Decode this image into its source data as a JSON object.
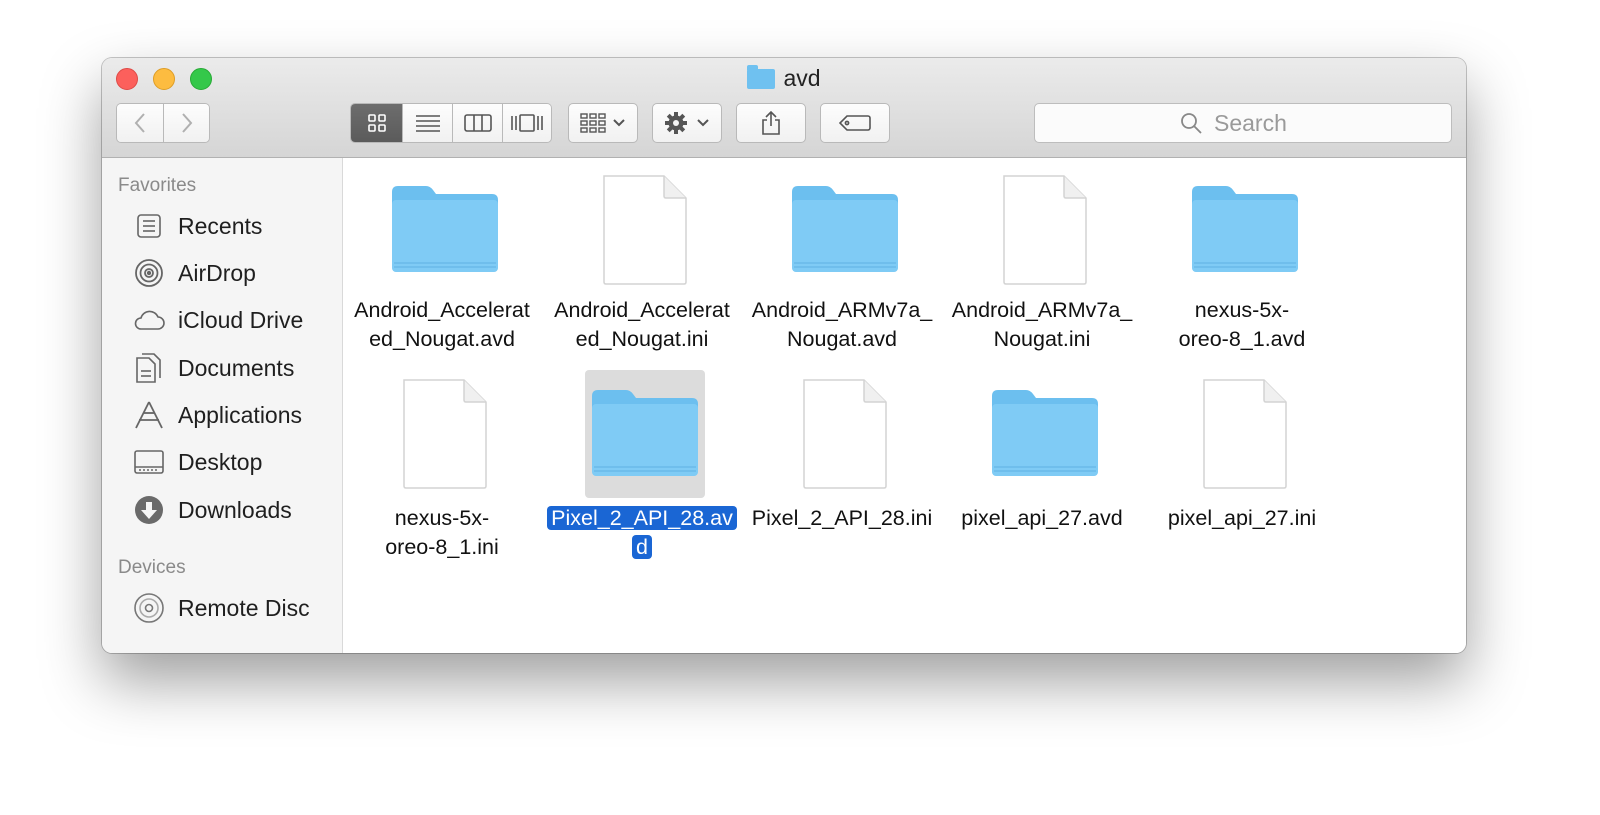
{
  "window": {
    "title": "avd"
  },
  "toolbar": {
    "back_icon": "chevron-left-icon",
    "forward_icon": "chevron-right-icon",
    "view_modes": [
      "icon-view",
      "list-view",
      "column-view",
      "cover-flow-view"
    ],
    "group_icon": "group-by-icon",
    "action_icon": "gear-icon",
    "share_icon": "share-icon",
    "tag_icon": "tag-icon"
  },
  "search": {
    "placeholder": "Search"
  },
  "sidebar": {
    "favorites_header": "Favorites",
    "favorites": [
      {
        "label": "Recents",
        "icon": "recents-icon"
      },
      {
        "label": "AirDrop",
        "icon": "airdrop-icon"
      },
      {
        "label": "iCloud Drive",
        "icon": "cloud-icon"
      },
      {
        "label": "Documents",
        "icon": "documents-icon"
      },
      {
        "label": "Applications",
        "icon": "applications-icon"
      },
      {
        "label": "Desktop",
        "icon": "desktop-icon"
      },
      {
        "label": "Downloads",
        "icon": "downloads-icon"
      }
    ],
    "devices_header": "Devices",
    "devices": [
      {
        "label": "Remote Disc",
        "icon": "disc-icon"
      }
    ]
  },
  "files": [
    {
      "name": "Android_Accelerated_Nougat.avd",
      "line1": "Android_Accelerat",
      "line2": "ed_Nougat.avd",
      "kind": "folder",
      "selected": false
    },
    {
      "name": "Android_Accelerated_Nougat.ini",
      "line1": "Android_Accelerat",
      "line2": "ed_Nougat.ini",
      "kind": "document",
      "selected": false
    },
    {
      "name": "Android_ARMv7a_Nougat.avd",
      "line1": "Android_ARMv7a_",
      "line2": "Nougat.avd",
      "kind": "folder",
      "selected": false
    },
    {
      "name": "Android_ARMv7a_Nougat.ini",
      "line1": "Android_ARMv7a_",
      "line2": "Nougat.ini",
      "kind": "document",
      "selected": false
    },
    {
      "name": "nexus-5x-oreo-8_1.avd",
      "line1": "nexus-5x-",
      "line2": "oreo-8_1.avd",
      "kind": "folder",
      "selected": false
    },
    {
      "name": "nexus-5x-oreo-8_1.ini",
      "line1": "nexus-5x-",
      "line2": "oreo-8_1.ini",
      "kind": "document",
      "selected": false
    },
    {
      "name": "Pixel_2_API_28.avd",
      "line1": "Pixel_2_API_28.av",
      "line2": "d",
      "kind": "folder",
      "selected": true
    },
    {
      "name": "Pixel_2_API_28.ini",
      "line1": "Pixel_2_API_28.ini",
      "line2": "",
      "kind": "document",
      "selected": false
    },
    {
      "name": "pixel_api_27.avd",
      "line1": "pixel_api_27.avd",
      "line2": "",
      "kind": "folder",
      "selected": false
    },
    {
      "name": "pixel_api_27.ini",
      "line1": "pixel_api_27.ini",
      "line2": "",
      "kind": "document",
      "selected": false
    }
  ],
  "colors": {
    "selection": "#1a66d4",
    "folder": "#6fc1f0"
  }
}
